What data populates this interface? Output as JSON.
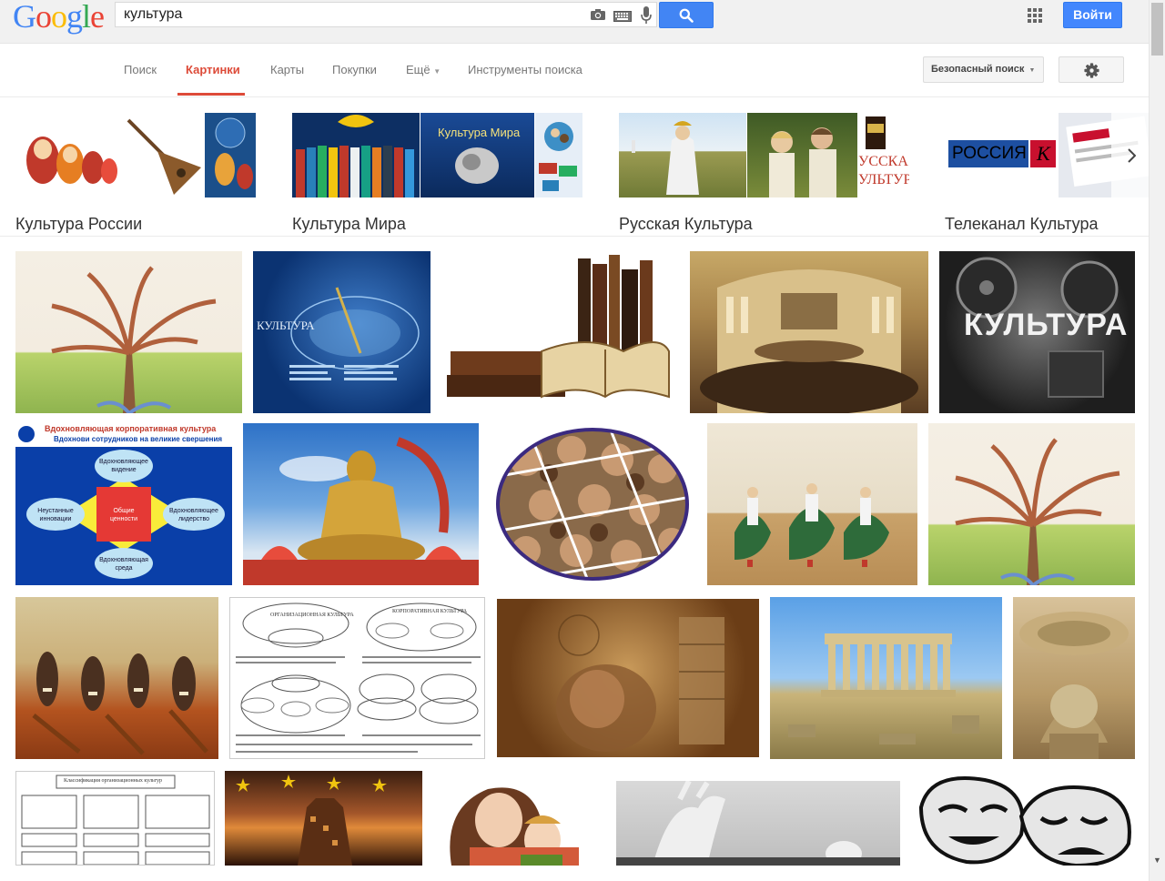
{
  "header": {
    "logo": [
      "G",
      "o",
      "o",
      "g",
      "l",
      "e"
    ],
    "logo_colors": [
      "#4285f4",
      "#ea4335",
      "#fbbc05",
      "#4285f4",
      "#34a853",
      "#ea4335"
    ],
    "query": "культура",
    "signin_label": "Войти"
  },
  "nav": {
    "tabs": [
      {
        "label": "Поиск"
      },
      {
        "label": "Картинки"
      },
      {
        "label": "Карты"
      },
      {
        "label": "Покупки"
      },
      {
        "label": "Ещё"
      },
      {
        "label": "Инструменты поиска"
      }
    ],
    "active_tab": "Картинки",
    "safe_search_label": "Безопасный поиск"
  },
  "related": [
    {
      "label": "Культура России"
    },
    {
      "label": "Культура Мира",
      "overlay": "Культура Мира"
    },
    {
      "label": "Русская Культура",
      "overlay": "УССКА\nУЛЬТУР"
    },
    {
      "label": "Телеканал Культура",
      "overlay": "РОССИЯ",
      "badge": "К"
    }
  ],
  "results": {
    "row1": [
      {
        "caption": ""
      },
      {
        "caption": "КУЛЬТУРА"
      },
      {
        "caption": ""
      },
      {
        "caption": ""
      },
      {
        "caption": "КУЛЬТУРА"
      }
    ],
    "row2": [
      {
        "caption": "Вдохновляющая корпоративная культура",
        "subcaption": "Вдохнови сотрудников на великие свершения",
        "nodes": [
          "Вдохновляющее видение",
          "Неустанные инновации",
          "Общие ценности",
          "Вдохновляющее лидерство",
          "Вдохновляющая среда"
        ]
      },
      {
        "caption": ""
      },
      {
        "caption": ""
      },
      {
        "caption": ""
      },
      {
        "caption": ""
      }
    ],
    "row3": [
      {
        "caption": ""
      },
      {
        "caption": "ОРГАНИЗАЦИОННАЯ КУЛЬТУРА",
        "subcaption": "КОРПОРАТИВНАЯ КУЛЬТУРА"
      },
      {
        "caption": ""
      },
      {
        "caption": ""
      },
      {
        "caption": ""
      }
    ],
    "row4": [
      {
        "caption": "Классификация организационных культур"
      },
      {
        "caption": ""
      },
      {
        "caption": ""
      },
      {
        "caption": ""
      },
      {
        "caption": ""
      }
    ]
  }
}
